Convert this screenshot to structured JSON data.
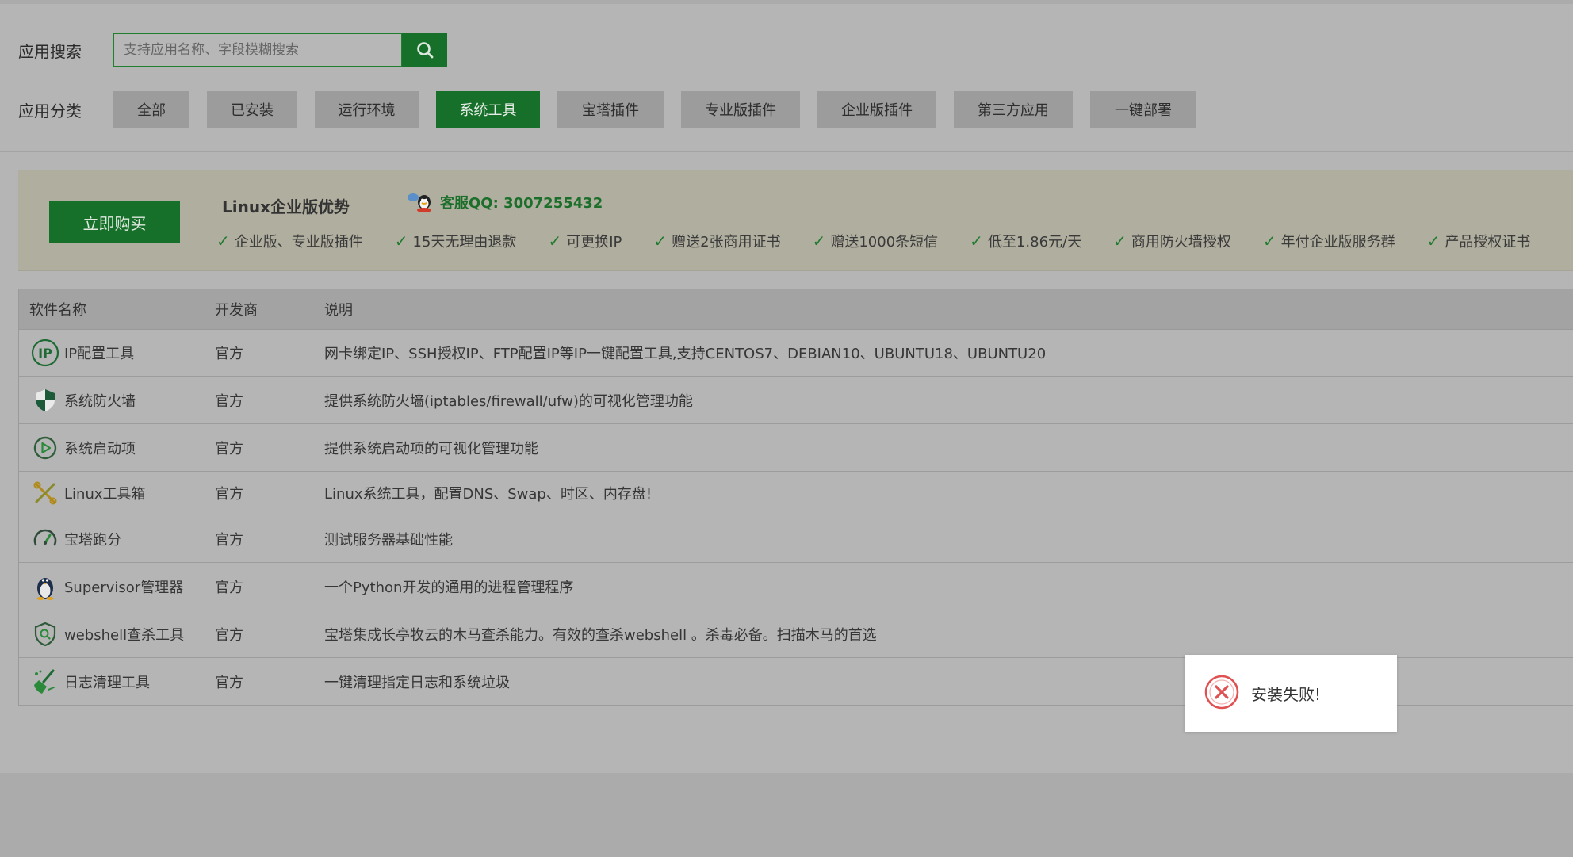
{
  "search": {
    "label": "应用搜索",
    "placeholder": "支持应用名称、字段模糊搜索",
    "value": ""
  },
  "categories": {
    "label": "应用分类",
    "items": [
      "全部",
      "已安装",
      "运行环境",
      "系统工具",
      "宝塔插件",
      "专业版插件",
      "企业版插件",
      "第三方应用",
      "一键部署"
    ],
    "active": "系统工具"
  },
  "promo": {
    "buy_label": "立即购买",
    "title": "Linux企业版优势",
    "qq_label": "客服QQ: 3007255432",
    "features": [
      "企业版、专业版插件",
      "15天无理由退款",
      "可更换IP",
      "赠送2张商用证书",
      "赠送1000条短信",
      "低至1.86元/天",
      "商用防火墙授权",
      "年付企业版服务群",
      "产品授权证书"
    ]
  },
  "table": {
    "headers": [
      "软件名称",
      "开发商",
      "说明"
    ],
    "rows": [
      {
        "icon": "ip-icon",
        "name": "IP配置工具",
        "developer": "官方",
        "desc": "网卡绑定IP、SSH授权IP、FTP配置IP等IP一键配置工具,支持CENTOS7、DEBIAN10、UBUNTU18、UBUNTU20"
      },
      {
        "icon": "shield-icon",
        "name": "系统防火墙",
        "developer": "官方",
        "desc": "提供系统防火墙(iptables/firewall/ufw)的可视化管理功能"
      },
      {
        "icon": "play-circle-icon",
        "name": "系统启动项",
        "developer": "官方",
        "desc": "提供系统启动项的可视化管理功能"
      },
      {
        "icon": "tools-icon",
        "name": "Linux工具箱",
        "developer": "官方",
        "desc": "Linux系统工具，配置DNS、Swap、时区、内存盘!"
      },
      {
        "icon": "gauge-icon",
        "name": "宝塔跑分",
        "developer": "官方",
        "desc": "测试服务器基础性能"
      },
      {
        "icon": "penguin-icon",
        "name": "Supervisor管理器",
        "developer": "官方",
        "desc": "一个Python开发的通用的进程管理程序"
      },
      {
        "icon": "shield-scan-icon",
        "name": "webshell查杀工具",
        "developer": "官方",
        "desc": "宝塔集成长亭牧云的木马查杀能力。有效的查杀webshell 。杀毒必备。扫描木马的首选"
      },
      {
        "icon": "broom-icon",
        "name": "日志清理工具",
        "developer": "官方",
        "desc": "一键清理指定日志和系统垃圾"
      }
    ]
  },
  "toast": {
    "icon": "error-circle-icon",
    "message": "安装失败!"
  },
  "colors": {
    "accent": "#16702a",
    "error": "#e05252"
  }
}
